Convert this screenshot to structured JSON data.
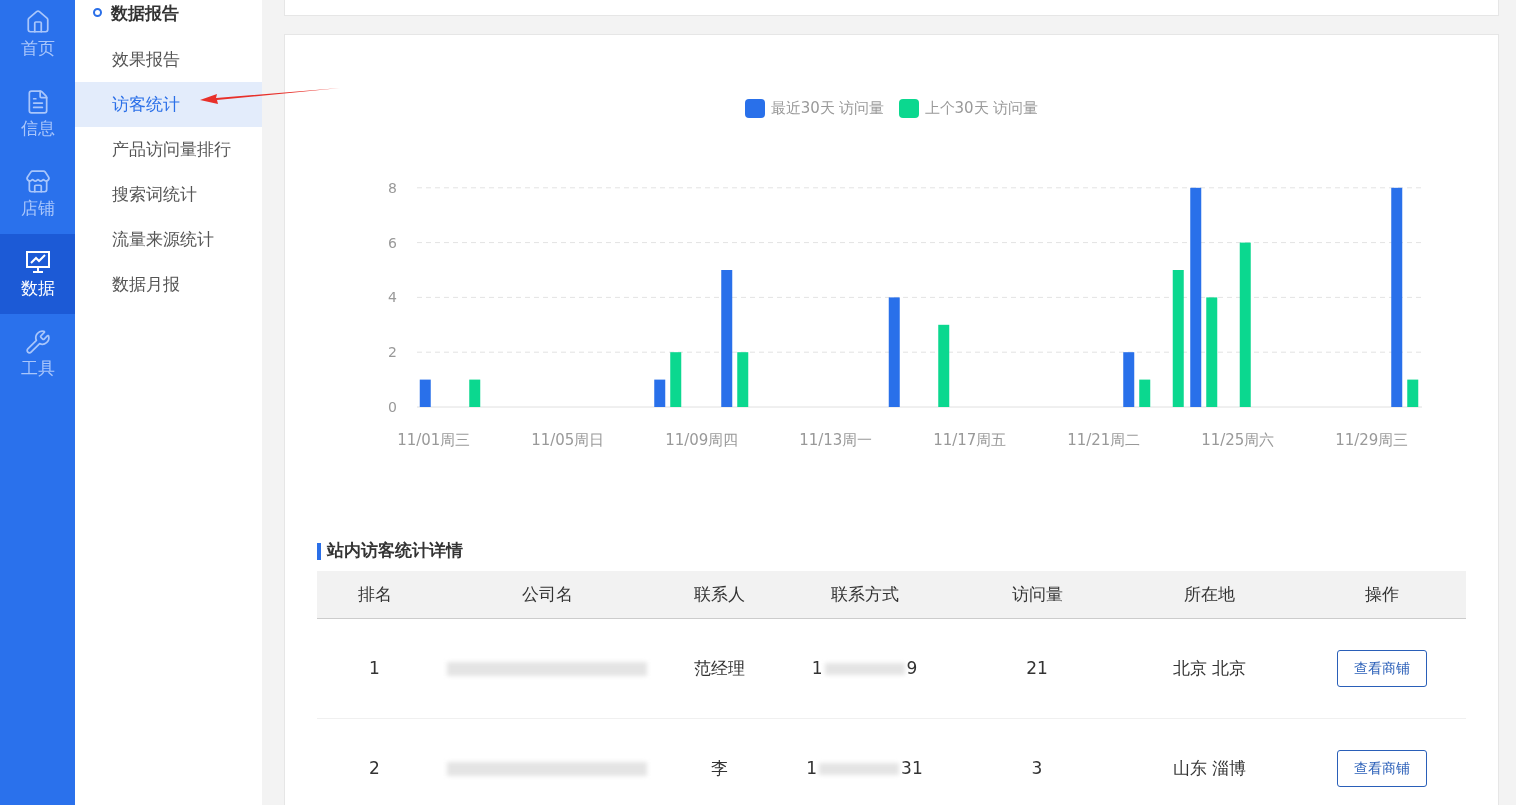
{
  "rail": [
    {
      "label": "首页",
      "kind": "home",
      "selected": false
    },
    {
      "label": "信息",
      "kind": "list",
      "selected": false
    },
    {
      "label": "店铺",
      "kind": "store",
      "selected": false
    },
    {
      "label": "数据",
      "kind": "monitor",
      "selected": true
    },
    {
      "label": "工具",
      "kind": "wrench",
      "selected": false
    }
  ],
  "submenu": {
    "heading": "数据报告",
    "items": [
      {
        "label": "效果报告",
        "selected": false
      },
      {
        "label": "访客统计",
        "selected": true
      },
      {
        "label": "产品访问量排行",
        "selected": false
      },
      {
        "label": "搜索词统计",
        "selected": false
      },
      {
        "label": "流量来源统计",
        "selected": false
      },
      {
        "label": "数据月报",
        "selected": false
      }
    ]
  },
  "chart": {
    "chart_data": {
      "type": "bar",
      "categories": [
        "11/01周三",
        null,
        null,
        null,
        "11/05周日",
        null,
        null,
        null,
        "11/09周四",
        null,
        null,
        null,
        "11/13周一",
        null,
        null,
        null,
        "11/17周五",
        null,
        null,
        null,
        "11/21周二",
        null,
        null,
        null,
        "11/25周六",
        null,
        null,
        null,
        "11/29周三",
        null
      ],
      "series": [
        {
          "name": "最近30天 访问量",
          "color": "#2970ea",
          "values": [
            1,
            0,
            0,
            0,
            0,
            0,
            0,
            1,
            0,
            5,
            0,
            0,
            0,
            0,
            4,
            0,
            0,
            0,
            0,
            0,
            0,
            2,
            0,
            8,
            0,
            0,
            0,
            0,
            0,
            8
          ]
        },
        {
          "name": "上个30天 访问量",
          "color": "#0bd88f",
          "values": [
            0,
            1,
            0,
            0,
            0,
            0,
            0,
            2,
            0,
            2,
            0,
            0,
            0,
            0,
            0,
            3,
            0,
            0,
            0,
            0,
            0,
            1,
            5,
            4,
            6,
            0,
            0,
            0,
            0,
            1
          ]
        }
      ],
      "ylim": [
        0,
        8
      ],
      "yticks": [
        0,
        2,
        4,
        6,
        8
      ],
      "grid": true
    }
  },
  "table": {
    "title": "站内访客统计详情",
    "columns": [
      "排名",
      "公司名",
      "联系人",
      "联系方式",
      "访问量",
      "所在地",
      "操作"
    ],
    "rows": [
      {
        "rank": "1",
        "contact": "范经理",
        "phone_start": "1",
        "phone_end": "9",
        "visits": "21",
        "location": "北京 北京",
        "action": "查看商铺"
      },
      {
        "rank": "2",
        "contact": "李",
        "phone_start": "1",
        "phone_end": "31",
        "visits": "3",
        "location": "山东 淄博",
        "action": "查看商铺"
      }
    ]
  }
}
